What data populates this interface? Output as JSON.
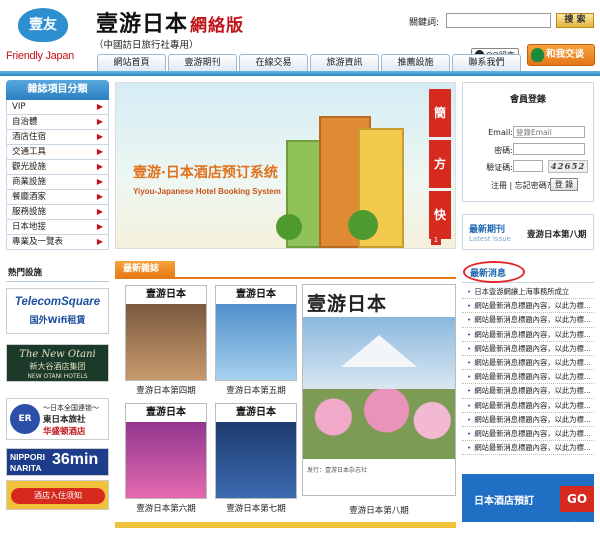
{
  "header": {
    "logo_badge": "壹友",
    "logo_text": "Friendly Japan",
    "site_title": "壹游日本",
    "site_version": "網絡版",
    "site_subtitle": "（中國訪日旅行社專用）",
    "keyword_label": "關鍵詞:",
    "keyword_value": "",
    "search_label": "搜 索",
    "qq_label": "QQ留言",
    "chat_label": "和我交谈"
  },
  "nav": {
    "tabs": [
      "網站首頁",
      "壹游期刊",
      "在線交易",
      "旅游資訊",
      "推薦設施",
      "聯系我們"
    ]
  },
  "sidebar": {
    "title": "雜誌項目分類",
    "categories": [
      "VIP",
      "自治體",
      "酒店住宿",
      "交通工具",
      "觀光設施",
      "商業設施",
      "餐廳酒家",
      "服務設施",
      "日本地接",
      "專業及一覽表"
    ],
    "hot_title": "熱門設施",
    "ads": {
      "tele_brand": "TelecomSquare",
      "tele_sub": "国外Wifi租賃",
      "otani_name": "The New Otani",
      "otani_cn": "新大谷酒店集团",
      "otani_en": "NEW OTANI HOTELS",
      "hotel_seal": "ER",
      "hotel_line1": "～日本全国連锁～",
      "hotel_line2": "東日本旅社",
      "hotel_line3": "华盛顿酒店",
      "narita_a": "NIPPORI",
      "narita_b": "NARITA",
      "narita_time": "36min",
      "last_ad": "酒店入住须知"
    }
  },
  "banner": {
    "title": "壹游·日本酒店预订系统",
    "subtitle": "Yiyou-Japanese Hotel Booking System",
    "side_tags": [
      "簡單",
      "方便",
      "快速"
    ],
    "page_num": "1"
  },
  "login": {
    "title": "會員登錄",
    "email_label": "Email:",
    "email_placeholder": "登錄Email",
    "password_label": "密碼:",
    "captcha_label": "驗证碼:",
    "captcha_value": "42652",
    "register_label": "注冊",
    "separator": "|",
    "forgot_label": "忘記密碼?",
    "login_button": "登 錄"
  },
  "latest_issue": {
    "label": "最新期刊",
    "label_en": "Latest Issue",
    "name": "壹游日本第八期"
  },
  "magazines": {
    "section_title": "最新雜誌",
    "cover_title": "壹游日本",
    "items": [
      {
        "caption": "壹游日本第四期",
        "color": "#8a5a3b"
      },
      {
        "caption": "壹游日本第五期",
        "color": "#4a8ec8"
      },
      {
        "caption": "壹游日本第六期",
        "color": "#b23a8f"
      },
      {
        "caption": "壹游日本第七期",
        "color": "#1c3d7a"
      }
    ],
    "featured_caption": "壹游日本第八期",
    "featured_title": "壹游日本",
    "featured_footer": "发行：壹游日本杂志社"
  },
  "news": {
    "title": "最新消息",
    "items": [
      "日本壹游網讓上海事務所成立",
      "網站最新消息標題內容，以此为標...",
      "網站最新消息標題內容，以此为標...",
      "網站最新消息標題內容，以此为標...",
      "網站最新消息標題內容，以此为標...",
      "網站最新消息標題內容，以此为標...",
      "網站最新消息標題內容，以此为標...",
      "網站最新消息標題內容，以此为標...",
      "網站最新消息標題內容，以此为標...",
      "網站最新消息標題內容，以此为標...",
      "網站最新消息標題內容，以此为標...",
      "網站最新消息標題內容，以此为標..."
    ]
  },
  "hotel_booking": {
    "label": "日本酒店預訂",
    "go": "GO >"
  }
}
